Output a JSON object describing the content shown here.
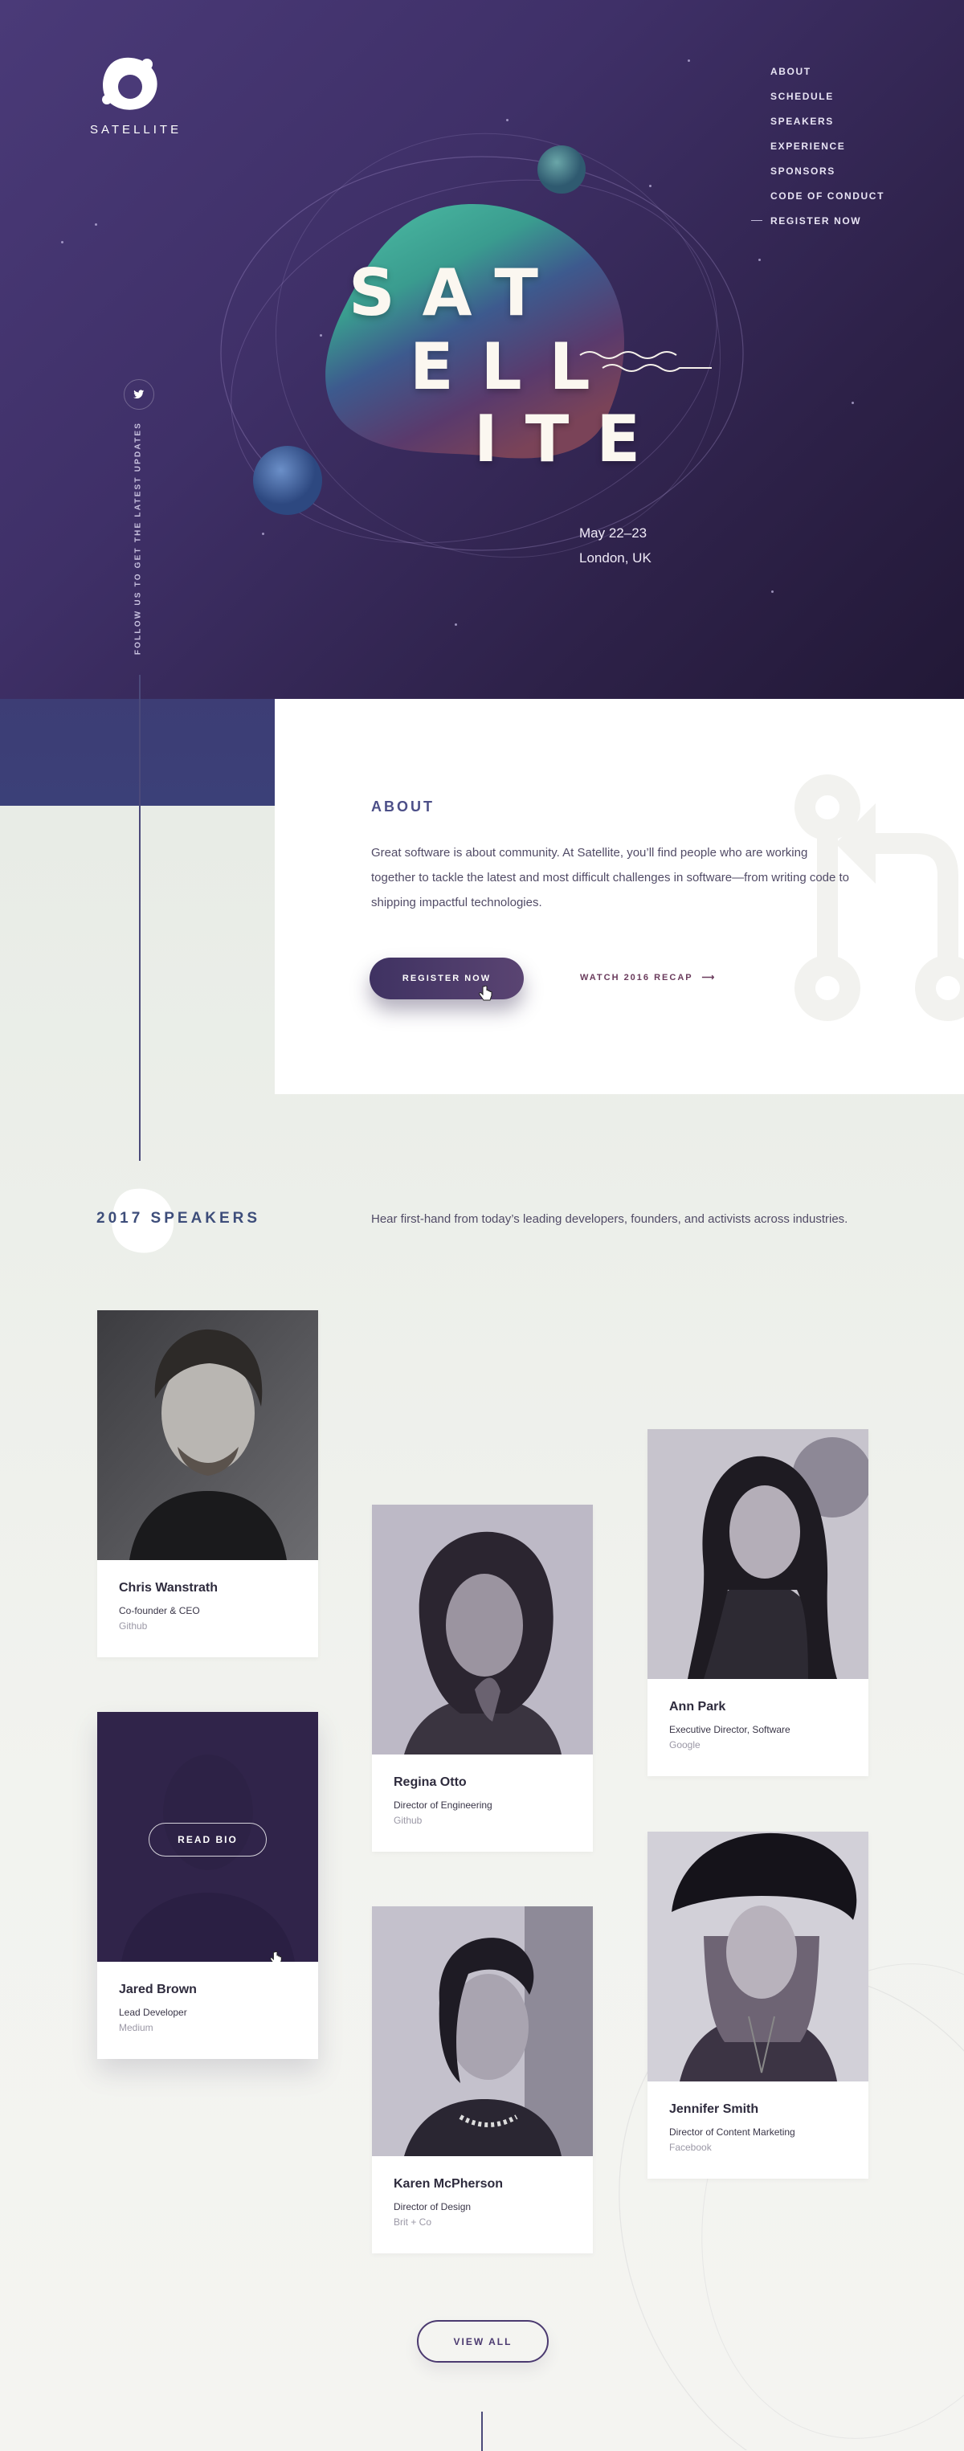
{
  "brand": {
    "logo_text": "SATELLITE"
  },
  "nav": {
    "items": [
      "ABOUT",
      "SCHEDULE",
      "SPEAKERS",
      "EXPERIENCE",
      "SPONSORS",
      "CODE OF CONDUCT",
      "REGISTER NOW"
    ]
  },
  "social": {
    "follow_text": "FOLLOW US TO GET THE LATEST UPDATES",
    "twitter_icon": "twitter-icon"
  },
  "hero": {
    "title_lines": [
      "SAT",
      "ELL",
      "ITE"
    ],
    "date": "May 22–23",
    "location": "London, UK"
  },
  "about": {
    "heading": "ABOUT",
    "body": "Great software is about community. At Satellite, you’ll find people who are working together to tackle the latest and most difficult challenges in software—from writing code to shipping impactful technologies.",
    "register_label": "REGISTER NOW",
    "watch_label": "WATCH 2016 RECAP",
    "watch_arrow": "⟶"
  },
  "speakers": {
    "heading": "2017 SPEAKERS",
    "intro": "Hear first-hand from today’s leading developers, founders, and activists across industries.",
    "read_bio_label": "READ BIO",
    "view_all_label": "VIEW ALL",
    "list": [
      {
        "name": "Chris Wanstrath",
        "role": "Co-founder & CEO",
        "company": "Github"
      },
      {
        "name": "Jared Brown",
        "role": "Lead Developer",
        "company": "Medium"
      },
      {
        "name": "Regina Otto",
        "role": "Director of Engineering",
        "company": "Github"
      },
      {
        "name": "Karen McPherson",
        "role": "Director of Design",
        "company": "Brit + Co"
      },
      {
        "name": "Ann Park",
        "role": "Executive Director, Software",
        "company": "Google"
      },
      {
        "name": "Jennifer Smith",
        "role": "Director of Content Marketing",
        "company": "Facebook"
      }
    ]
  },
  "colors": {
    "hero_purple": "#3f3068",
    "accent_navy": "#4c4f88",
    "button_purple": "#4b3a70"
  }
}
